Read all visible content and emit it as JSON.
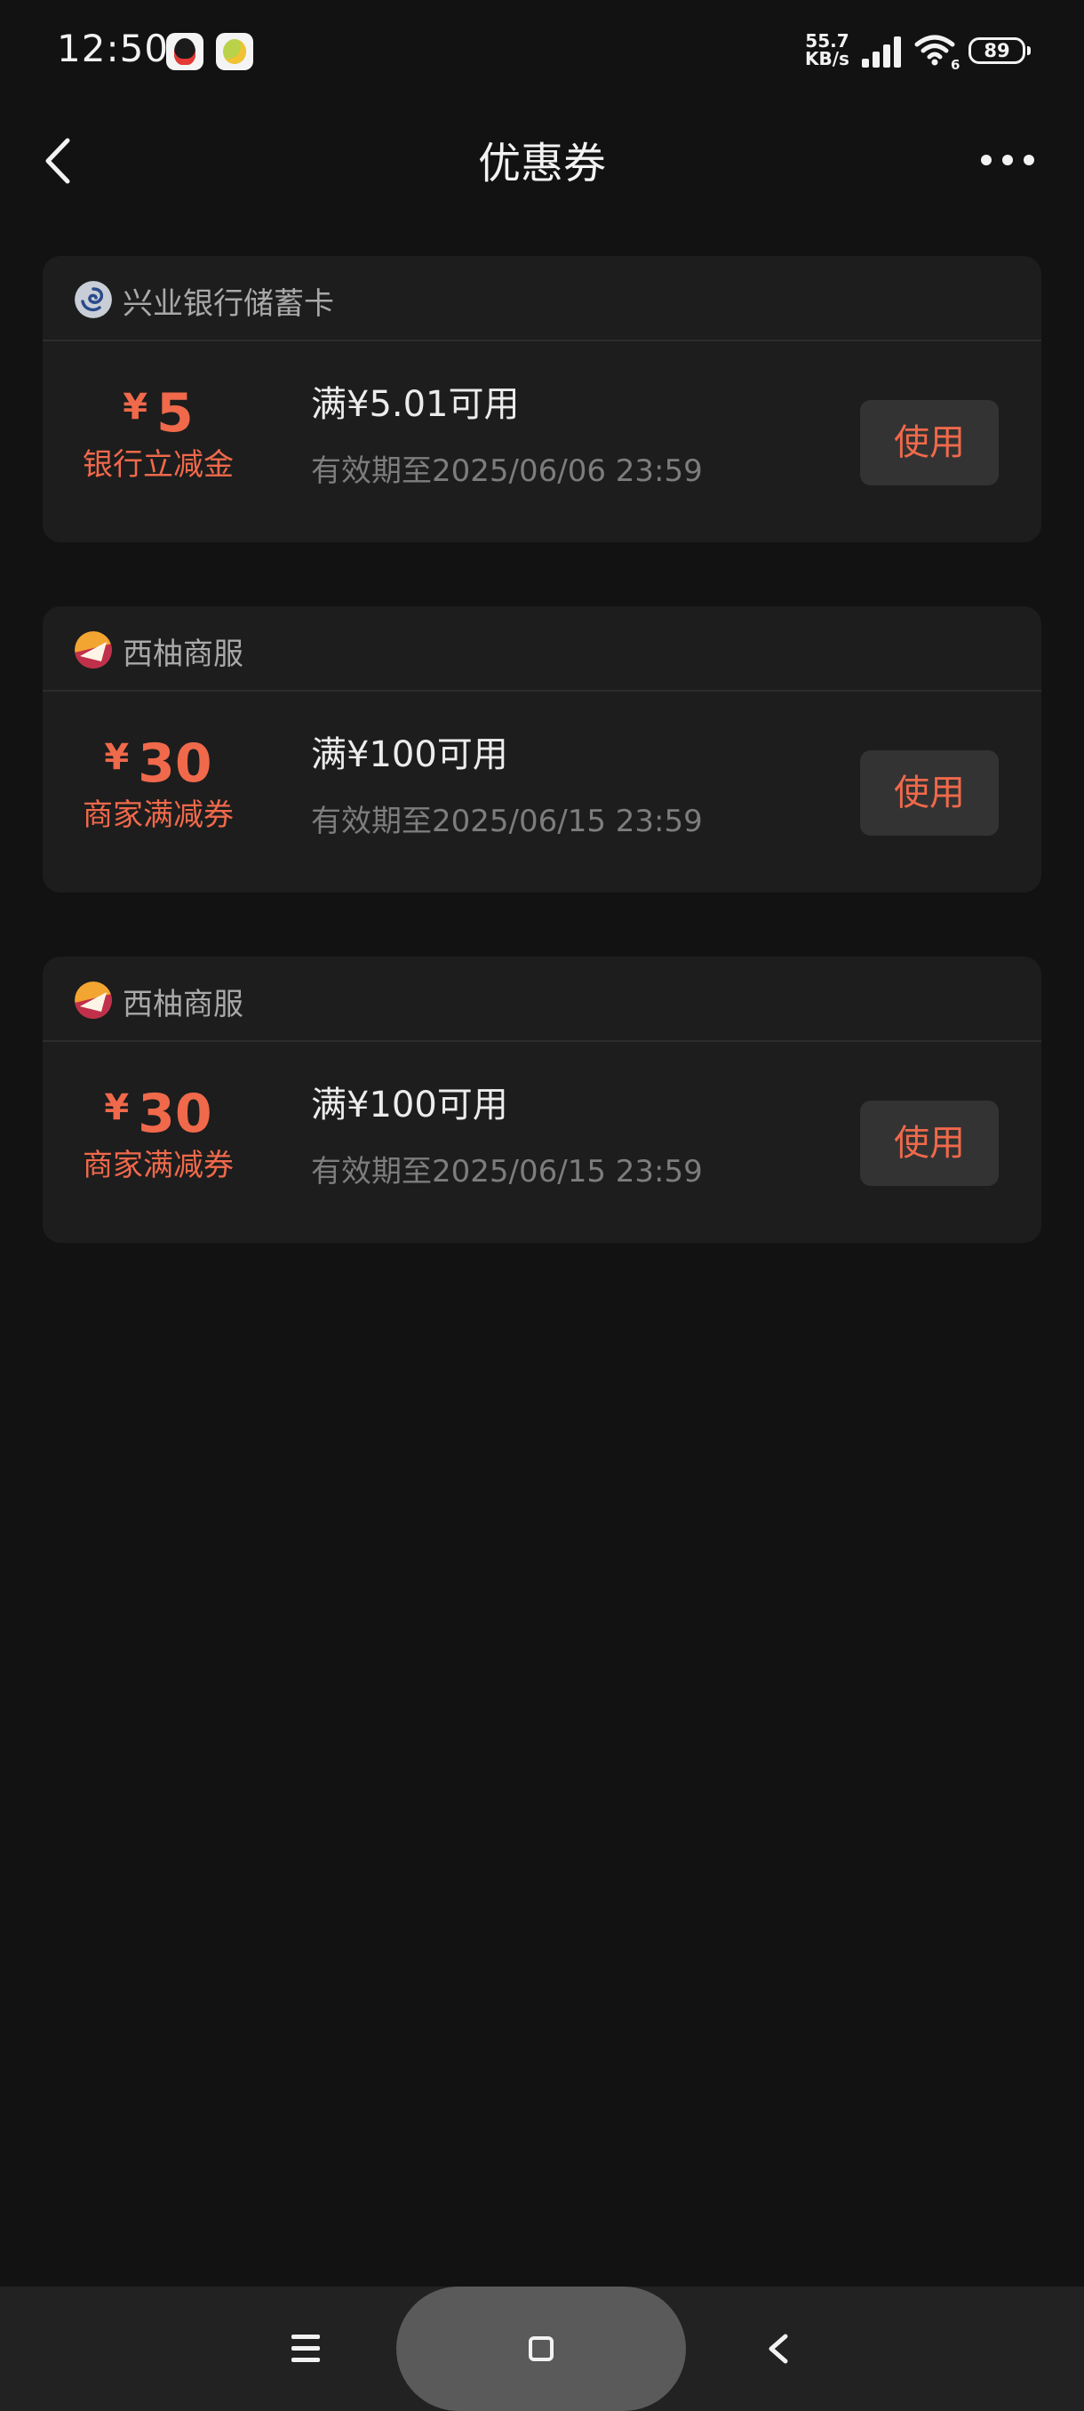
{
  "status_bar": {
    "time": "12:50",
    "net_speed_value": "55.7",
    "net_speed_unit": "KB/s",
    "wifi_label": "6",
    "battery": "89"
  },
  "header": {
    "title": "优惠券"
  },
  "coupons": [
    {
      "merchant": "兴业银行储蓄卡",
      "logo": "bank-logo-icon",
      "currency": "¥",
      "amount": "5",
      "type": "银行立减金",
      "condition": "满¥5.01可用",
      "validity": "有效期至2025/06/06 23:59",
      "button": "使用"
    },
    {
      "merchant": "西柚商服",
      "logo": "grapefruit-logo-icon",
      "currency": "¥",
      "amount": "30",
      "type": "商家满减券",
      "condition": "满¥100可用",
      "validity": "有效期至2025/06/15 23:59",
      "button": "使用"
    },
    {
      "merchant": "西柚商服",
      "logo": "grapefruit-logo-icon",
      "currency": "¥",
      "amount": "30",
      "type": "商家满减券",
      "condition": "满¥100可用",
      "validity": "有效期至2025/06/15 23:59",
      "button": "使用"
    }
  ],
  "colors": {
    "background": "#121212",
    "card": "#1d1d1d",
    "accent": "#f0694b",
    "button_bg": "#333333"
  }
}
